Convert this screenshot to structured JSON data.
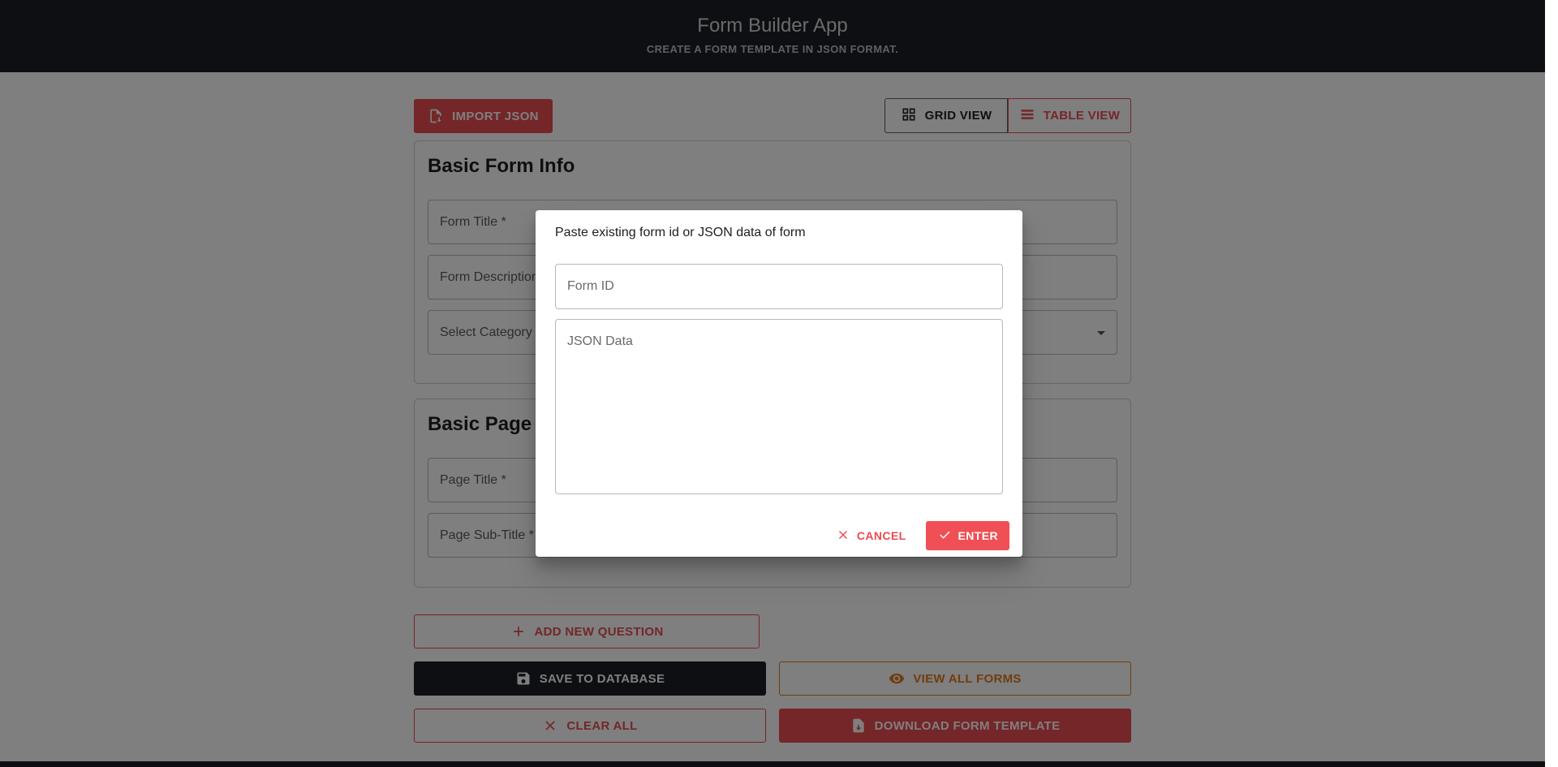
{
  "header": {
    "title": "Form Builder App",
    "subtitle": "CREATE A FORM TEMPLATE IN JSON FORMAT."
  },
  "toolbar": {
    "import_label": "IMPORT JSON",
    "grid_view_label": "GRID VIEW",
    "table_view_label": "TABLE VIEW"
  },
  "form_info": {
    "heading": "Basic Form Info",
    "title_label": "Form Title *",
    "description_label": "Form Description",
    "category_label": "Select Category"
  },
  "page_info": {
    "heading": "Basic Page I",
    "title_label": "Page Title *",
    "subtitle_label": "Page Sub-Title *"
  },
  "actions": {
    "add_question": "ADD NEW QUESTION",
    "save_db": "SAVE TO DATABASE",
    "view_forms": "VIEW ALL FORMS",
    "clear_all": "CLEAR ALL",
    "download": "DOWNLOAD FORM TEMPLATE"
  },
  "dialog": {
    "title": "Paste existing form id or JSON data of form",
    "form_id_placeholder": "Form ID",
    "json_placeholder": "JSON Data",
    "cancel_label": "CANCEL",
    "enter_label": "ENTER"
  },
  "icons": {
    "import": "file-import-icon",
    "grid": "grid-icon",
    "table": "table-rows-icon",
    "add": "plus-icon",
    "save": "floppy-disk-icon",
    "view": "eye-icon",
    "clear": "close-icon",
    "download": "file-download-icon",
    "cancel": "close-icon",
    "enter": "check-icon"
  },
  "colors": {
    "primary_red": "#e84c50",
    "header_dark": "#1b1f24",
    "orange": "#e07b1a"
  }
}
